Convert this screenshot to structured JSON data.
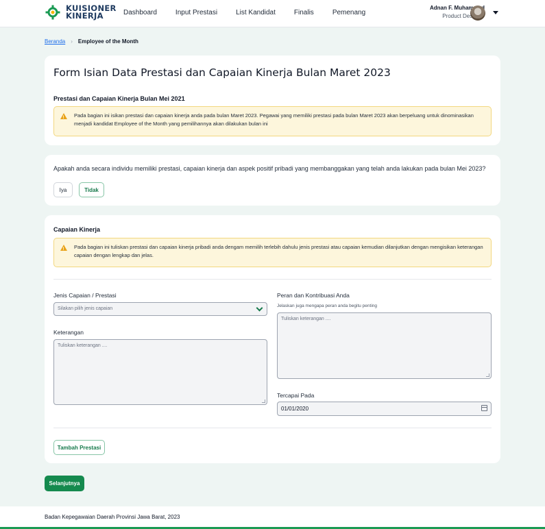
{
  "header": {
    "logo_line1": "KUISIONER",
    "logo_line2": "KINERJA",
    "nav": [
      "Dashboard",
      "Input Prestasi",
      "List Kandidat",
      "Finalis",
      "Pemenang"
    ],
    "user_name": "Adnan F. Muhammad",
    "user_role": "Product Designer"
  },
  "breadcrumb": {
    "home": "Beranda",
    "current": "Employee of the Month"
  },
  "card1": {
    "title": "Form Isian Data Prestasi dan Capaian Kinerja Bulan Maret 2023",
    "subtitle": "Prestasi dan Capaian Kinerja Bulan Mei 2021",
    "alert_line1": "Pada bagian ini isikan prestasi dan capaian kinerja anda pada bulan Maret 2023. Pegawai yang memiliki prestasi pada bulan Maret 2023 akan berpeluang untuk dinominasikan",
    "alert_line2": "menjadi kandidat Employee of the Month yang pemilihannya akan dilakukan bulan ini"
  },
  "card2": {
    "question": "Apakah anda secara individu memiliki prestasi, capaian kinerja dan aspek positif pribadi yang membanggakan yang telah anda lakukan pada bulan Mei 2023?",
    "option_yes": "Iya",
    "option_no": "Tidak",
    "selected": "Tidak"
  },
  "card3": {
    "title": "Capaian Kinerja",
    "alert_line1": "Pada bagian ini tuliskan prestasi dan capaian kinerja pribadi anda dengam memilih terlebih dahulu jenis prestasi atau capaian kemudian dilanjutkan dengan mengisikan keterangan",
    "alert_line2": "capaian dengan lengkap dan jelas.",
    "jenis_label": "Jenis Capaian / Prestasi",
    "jenis_placeholder": "Silakan pilih jenis capaian",
    "keterangan_label": "Keterangan",
    "keterangan_placeholder": "Tuliskan keterangan ....",
    "peran_label": "Peran dan Kontribuasi Anda",
    "peran_hint": "Jelaskan juga mengapa peran anda begitu penting",
    "peran_placeholder": "Tuliskan keterangan ....",
    "tercapai_label": "Tercapai Pada",
    "tercapai_value": "01/01/2020",
    "add_button": "Tambah Prestasi"
  },
  "next_button": "Selanjutnya",
  "footer": "Badan Kepegawaian Daerah Provinsi Jawa Barat, 2023",
  "colors": {
    "primary_green": "#158a4e",
    "alert_bg": "#fdf6dc",
    "alert_border": "#f2d77e",
    "page_bg": "#eef5f3"
  }
}
